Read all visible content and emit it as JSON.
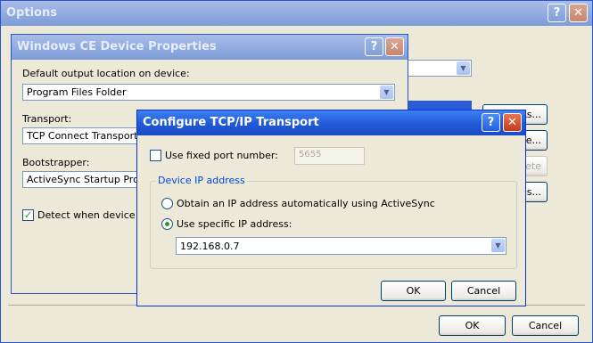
{
  "options_window": {
    "title": "Options",
    "help": "?",
    "close": "✕",
    "buttons": {
      "save_as": "As...",
      "rename": "me...",
      "delete": "ete",
      "properties": "ties...",
      "ok": "OK",
      "cancel": "Cancel"
    }
  },
  "device_properties": {
    "title": "Windows CE Device Properties",
    "help": "?",
    "close": "✕",
    "output_label": "Default output location on device:",
    "output_value": "Program Files Folder",
    "transport_label": "Transport:",
    "transport_value": "TCP Connect Transport",
    "bootstrapper_label": "Bootstrapper:",
    "bootstrapper_value": "ActiveSync Startup Provid",
    "detect_label": "Detect when device is c",
    "detect_checked": true
  },
  "tcpip": {
    "title": "Configure TCP/IP Transport",
    "help": "?",
    "close": "✕",
    "fixed_port_label": "Use fixed port number:",
    "fixed_port_checked": false,
    "port_value": "5655",
    "group_caption": "Device IP address",
    "radio_auto_label": "Obtain an IP address automatically using ActiveSync",
    "radio_specific_label": "Use specific IP address:",
    "selected_option": "specific",
    "ip_value": "192.168.0.7",
    "ok": "OK",
    "cancel": "Cancel"
  },
  "icons": {
    "dropdown": "chevron-down-icon",
    "checkmark": "check-icon"
  },
  "colors": {
    "titlebar_active": "#2158d8",
    "titlebar_inactive": "#8ea9e0",
    "dialog_bg": "#ece9d8",
    "group_caption": "#0046d5",
    "check_green": "#21a121",
    "close_red": "#c6391c"
  }
}
